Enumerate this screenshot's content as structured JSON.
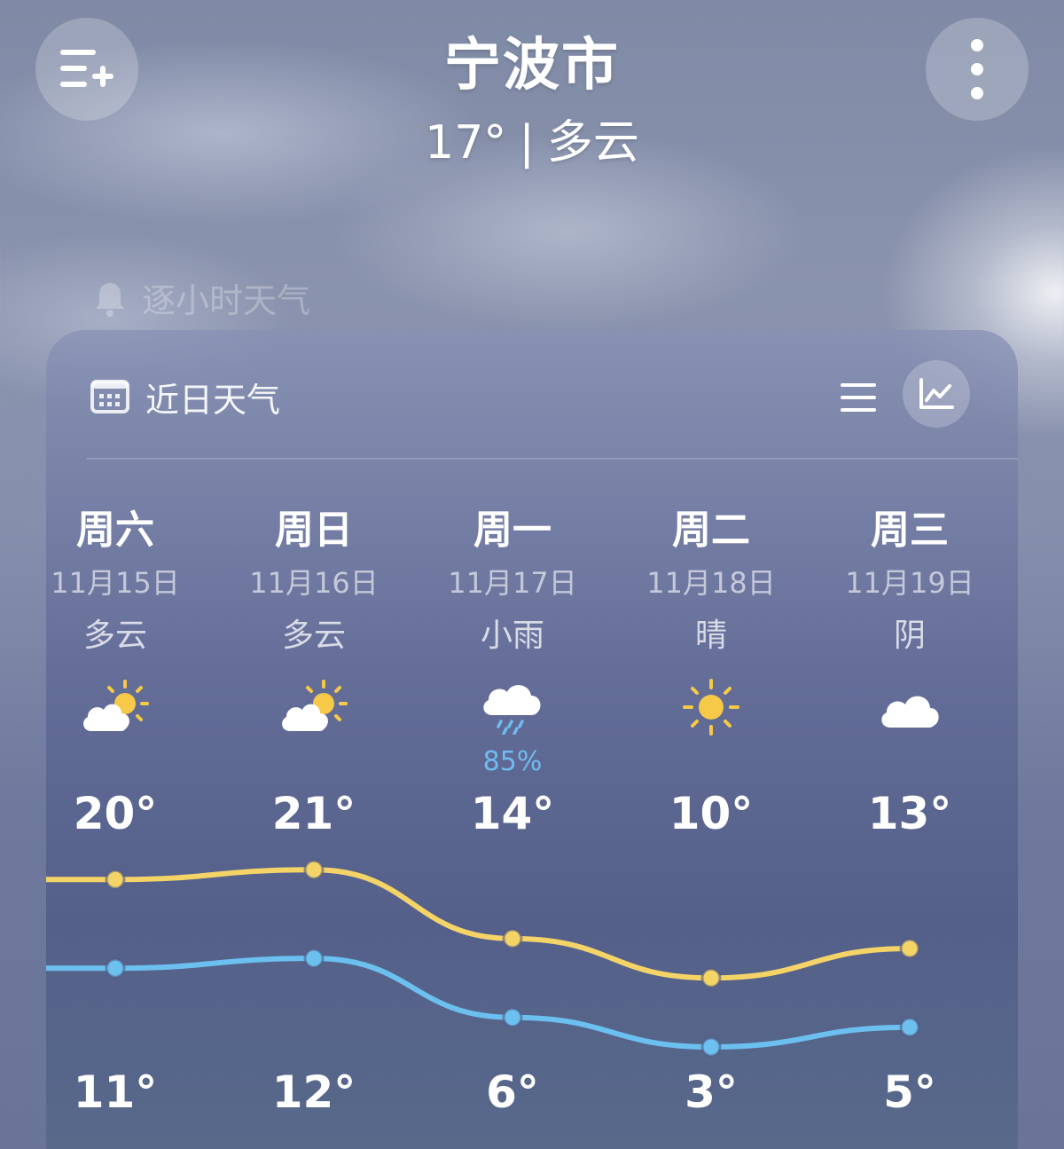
{
  "header": {
    "city": "宁波市",
    "current_temp": "17°",
    "separator": "|",
    "current_condition": "多云",
    "add_city_icon": "list-add-icon",
    "more_icon": "more-vertical-icon"
  },
  "hourly_hint": {
    "icon": "bell-icon",
    "label": "逐小时天气"
  },
  "forecast": {
    "title": "近日天气",
    "calendar_icon": "calendar-icon",
    "list_view_icon": "list-view-icon",
    "chart_view_icon": "line-chart-icon",
    "days": [
      {
        "dow": "周六",
        "date": "11月15日",
        "condition": "多云",
        "icon": "partly-cloudy-icon",
        "precip": "",
        "high": "20°",
        "low": "11°"
      },
      {
        "dow": "周日",
        "date": "11月16日",
        "condition": "多云",
        "icon": "partly-cloudy-icon",
        "precip": "",
        "high": "21°",
        "low": "12°"
      },
      {
        "dow": "周一",
        "date": "11月17日",
        "condition": "小雨",
        "icon": "light-rain-icon",
        "precip": "85%",
        "high": "14°",
        "low": "6°"
      },
      {
        "dow": "周二",
        "date": "11月18日",
        "condition": "晴",
        "icon": "sunny-icon",
        "precip": "",
        "high": "10°",
        "low": "3°"
      },
      {
        "dow": "周三",
        "date": "11月19日",
        "condition": "阴",
        "icon": "overcast-icon",
        "precip": "",
        "high": "13°",
        "low": "5°"
      }
    ]
  },
  "chart_data": {
    "type": "line",
    "categories": [
      "周六",
      "周日",
      "周一",
      "周二",
      "周三"
    ],
    "series": [
      {
        "values": [
          20,
          21,
          14,
          10,
          13
        ],
        "color": "#f5d467"
      },
      {
        "values": [
          11,
          12,
          6,
          3,
          5
        ],
        "color": "#6cc0f0"
      }
    ]
  },
  "colors": {
    "high_line": "#f5d467",
    "low_line": "#6cc0f0",
    "precip_text": "#6fbcf0",
    "sun": "#f7c948"
  }
}
